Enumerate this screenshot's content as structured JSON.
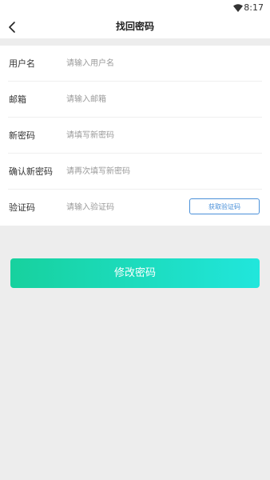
{
  "status_bar": {
    "time": "8:17"
  },
  "header": {
    "title": "找回密码"
  },
  "form": {
    "rows": [
      {
        "label": "用户名",
        "placeholder": "请输入用户名"
      },
      {
        "label": "邮箱",
        "placeholder": "请输入邮箱"
      },
      {
        "label": "新密码",
        "placeholder": "请填写新密码"
      },
      {
        "label": "确认新密码",
        "placeholder": "请再次填写新密码"
      },
      {
        "label": "验证码",
        "placeholder": "请输入验证码"
      }
    ],
    "get_code_label": "获取验证码"
  },
  "submit_label": "修改密码",
  "colors": {
    "accent_start": "#17d19e",
    "accent_end": "#21e6dc",
    "link_blue": "#4a90d9"
  }
}
